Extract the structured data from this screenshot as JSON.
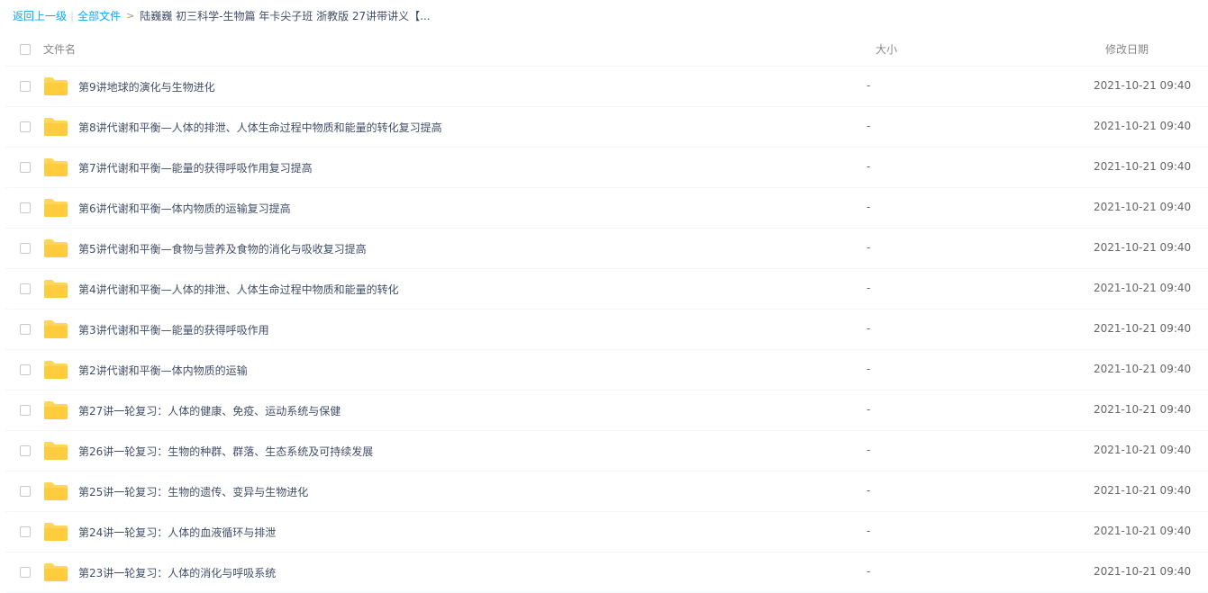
{
  "breadcrumb": {
    "back": "返回上一级",
    "separator": "|",
    "all_files": "全部文件",
    "arrow": ">",
    "current": "陆巍巍 初三科学-生物篇 年卡尖子班 浙教版 27讲带讲义【..."
  },
  "header": {
    "name": "文件名",
    "size": "大小",
    "date": "修改日期"
  },
  "files": [
    {
      "name": "第9讲地球的演化与生物进化",
      "size": "-",
      "date": "2021-10-21 09:40"
    },
    {
      "name": "第8讲代谢和平衡—人体的排泄、人体生命过程中物质和能量的转化复习提高",
      "size": "-",
      "date": "2021-10-21 09:40"
    },
    {
      "name": "第7讲代谢和平衡—能量的获得呼吸作用复习提高",
      "size": "-",
      "date": "2021-10-21 09:40"
    },
    {
      "name": "第6讲代谢和平衡—体内物质的运输复习提高",
      "size": "-",
      "date": "2021-10-21 09:40"
    },
    {
      "name": "第5讲代谢和平衡—食物与营养及食物的消化与吸收复习提高",
      "size": "-",
      "date": "2021-10-21 09:40"
    },
    {
      "name": "第4讲代谢和平衡—人体的排泄、人体生命过程中物质和能量的转化",
      "size": "-",
      "date": "2021-10-21 09:40"
    },
    {
      "name": "第3讲代谢和平衡—能量的获得呼吸作用",
      "size": "-",
      "date": "2021-10-21 09:40"
    },
    {
      "name": "第2讲代谢和平衡—体内物质的运输",
      "size": "-",
      "date": "2021-10-21 09:40"
    },
    {
      "name": "第27讲一轮复习：人体的健康、免疫、运动系统与保健",
      "size": "-",
      "date": "2021-10-21 09:40"
    },
    {
      "name": "第26讲一轮复习：生物的种群、群落、生态系统及可持续发展",
      "size": "-",
      "date": "2021-10-21 09:40"
    },
    {
      "name": "第25讲一轮复习：生物的遗传、变异与生物进化",
      "size": "-",
      "date": "2021-10-21 09:40"
    },
    {
      "name": "第24讲一轮复习：人体的血液循环与排泄",
      "size": "-",
      "date": "2021-10-21 09:40"
    },
    {
      "name": "第23讲一轮复习：人体的消化与呼吸系统",
      "size": "-",
      "date": "2021-10-21 09:40"
    }
  ],
  "icons": {
    "folder": "folder-icon",
    "checkbox": "checkbox"
  },
  "colors": {
    "link": "#09aaff",
    "folder": "#ffd659",
    "text": "#424e67"
  }
}
